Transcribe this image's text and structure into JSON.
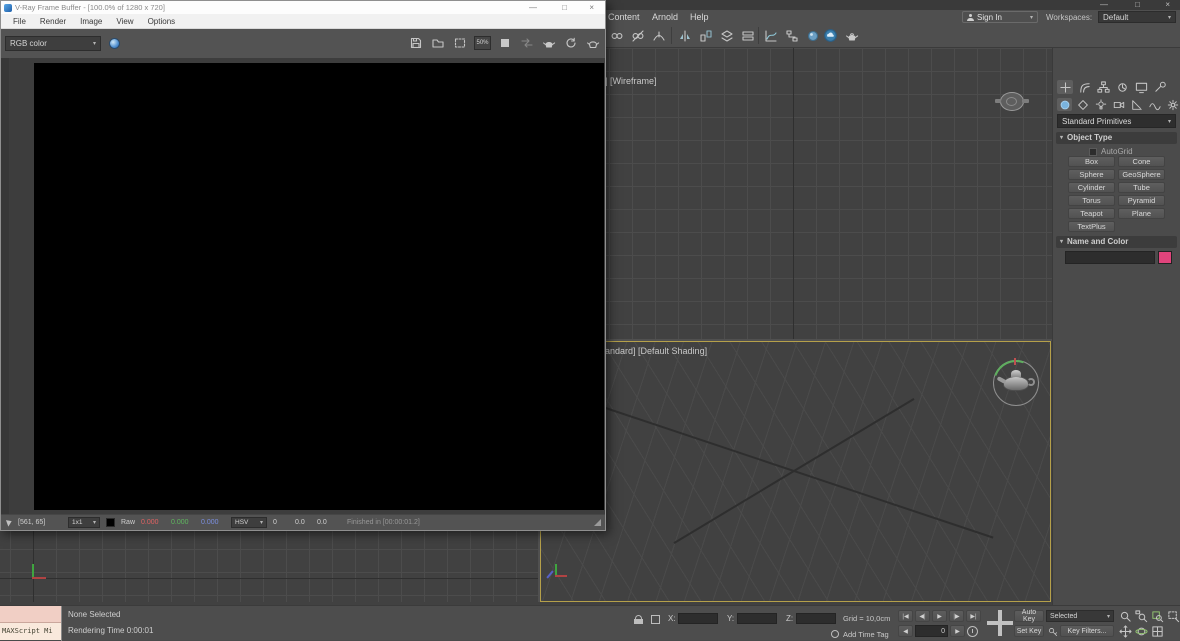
{
  "icons": {
    "chevron_down": "▾",
    "minimize": "—",
    "maximize": "□",
    "close": "×"
  },
  "colors": {
    "viewport_bg": "#414141",
    "active_viewport_border": "#b5a04a",
    "object_color_swatch": "#e0447c",
    "vray_icon_blue": "#2f7fd0"
  },
  "vfb": {
    "title": "V-Ray Frame Buffer - [100.0% of 1280 x 720]",
    "menus": [
      "File",
      "Render",
      "Image",
      "View",
      "Options"
    ],
    "channel_select": "RGB color",
    "zoom_badge": "50%",
    "status": {
      "pixel_coords": "[561, 65]",
      "zoom": "1x1",
      "raw_label": "Raw",
      "r": "0.000",
      "g": "0.000",
      "b": "0.000",
      "colorspace": "HSV",
      "h": "0",
      "s": "0.0",
      "v": "0.0",
      "finished": "Finished in [00:00:01.2]"
    }
  },
  "max": {
    "menus": [
      "Content",
      "Arnold",
      "Help"
    ],
    "signin_label": "Sign In",
    "workspaces_label": "Workspaces:",
    "workspace_value": "Default",
    "viewport_top_label": "] [Wireframe]",
    "viewport_persp_label": "andard] [Default Shading]",
    "panel": {
      "primitives": "Standard Primitives",
      "object_type": "Object Type",
      "autogrid": "AutoGrid",
      "buttons": [
        "Box",
        "Cone",
        "Sphere",
        "GeoSphere",
        "Cylinder",
        "Tube",
        "Torus",
        "Pyramid",
        "Teapot",
        "Plane",
        "TextPlus"
      ],
      "name_and_color": "Name and Color"
    },
    "status": {
      "maxscript": "MAXScript Mi",
      "selection": "None Selected",
      "rendering_time": "Rendering Time 0:00:01",
      "x": "X:",
      "y": "Y:",
      "z": "Z:",
      "grid": "Grid = 10,0cm",
      "add_time_tag": "Add Time Tag",
      "frame": "0",
      "auto_key": "Auto Key",
      "set_key": "Set Key",
      "selection_set": "Selected",
      "key_filters": "Key Filters...",
      "play": {
        "start": "|◀",
        "prev": "◀|",
        "play": "▶",
        "next": "|▶",
        "end": "▶|",
        "back": "◀",
        "fwd": "▶"
      }
    }
  }
}
